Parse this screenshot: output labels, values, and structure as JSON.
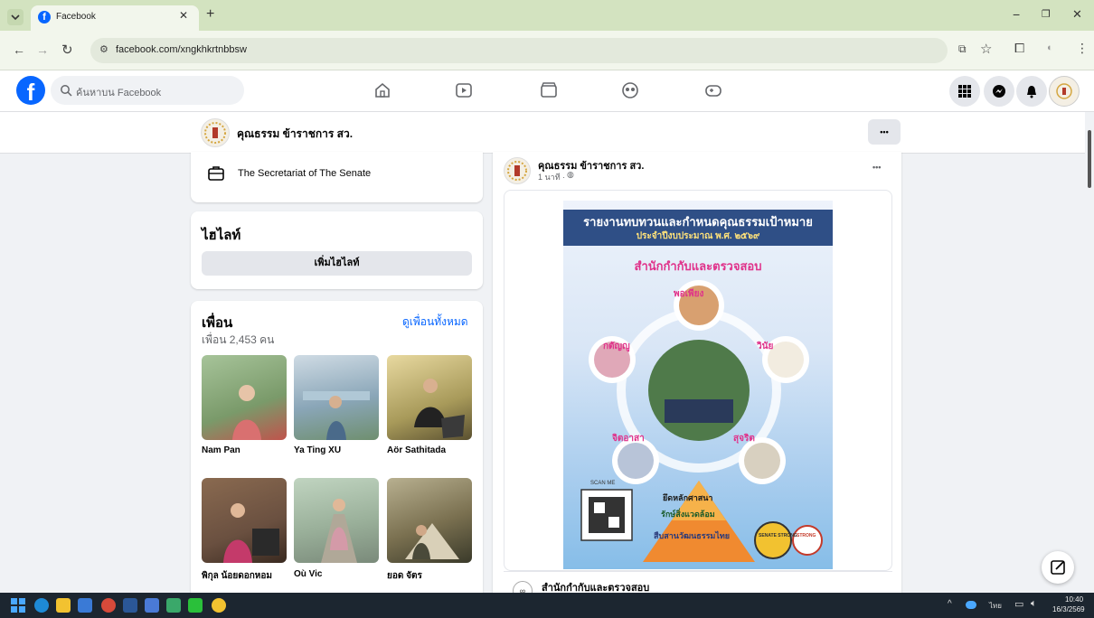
{
  "browser": {
    "tab_title": "Facebook",
    "url": "facebook.com/xngkhkrtnbbsw"
  },
  "fb_header": {
    "search_placeholder": "ค้นหาบน Facebook"
  },
  "page": {
    "name": "คุณธรรม ข้าราชการ สว.",
    "more_label": "•••"
  },
  "intro": {
    "org_name": "The Secretariat of The Senate"
  },
  "highlights": {
    "title": "ไฮไลท์",
    "add_button": "เพิ่มไฮไลท์"
  },
  "friends": {
    "title": "เพื่อน",
    "count_text": "เพื่อน 2,453 คน",
    "see_all": "ดูเพื่อนทั้งหมด",
    "items": [
      {
        "name": "Nam Pan",
        "color": "#7a9a6a"
      },
      {
        "name": "Ya Ting XU",
        "color": "#8aa6b8"
      },
      {
        "name": "Aör Sathitada",
        "color": "#a89a5a"
      },
      {
        "name": "พิกุล น้อยดอกหอม",
        "color": "#6a5040"
      },
      {
        "name": "Où Vic",
        "color": "#9ab09a"
      },
      {
        "name": "ยอด จัตร",
        "color": "#7a7050"
      }
    ]
  },
  "post": {
    "author": "คุณธรรม ข้าราชการ สว.",
    "time": "1 นาที · ",
    "more_label": "•••",
    "poster": {
      "title_line1": "รายงานทบทวนและกำหนดคุณธรรมเป้าหมาย",
      "title_line2": "ประจำปีงบประมาณ พ.ศ. ๒๕๖๙",
      "dept": "สำนักกำกับและตรวจสอบ",
      "virtue_top": "พอเพียง",
      "virtue_left": "กตัญญู",
      "virtue_right": "วินัย",
      "virtue_bottom_left": "จิตอาสา",
      "virtue_bottom_right": "สุจริต",
      "pyramid_1": "ยึดหลักศาสนา",
      "pyramid_2": "รักษ์สิ่งแวดล้อม",
      "pyramid_3": "สืบสานวัฒนธรรมไทย",
      "scan_label": "SCAN ME",
      "badge_1": "SENATE STRONG",
      "badge_2": "STRONG"
    },
    "shared_page": "สำนักกำกับและตรวจสอบ"
  },
  "taskbar": {
    "lang": "ไทย",
    "time": "10:40",
    "date": "16/3/2569"
  },
  "colors": {
    "fb_blue": "#0866ff",
    "tab_green": "#d3e3c0",
    "taskbar": "#1c2630"
  }
}
